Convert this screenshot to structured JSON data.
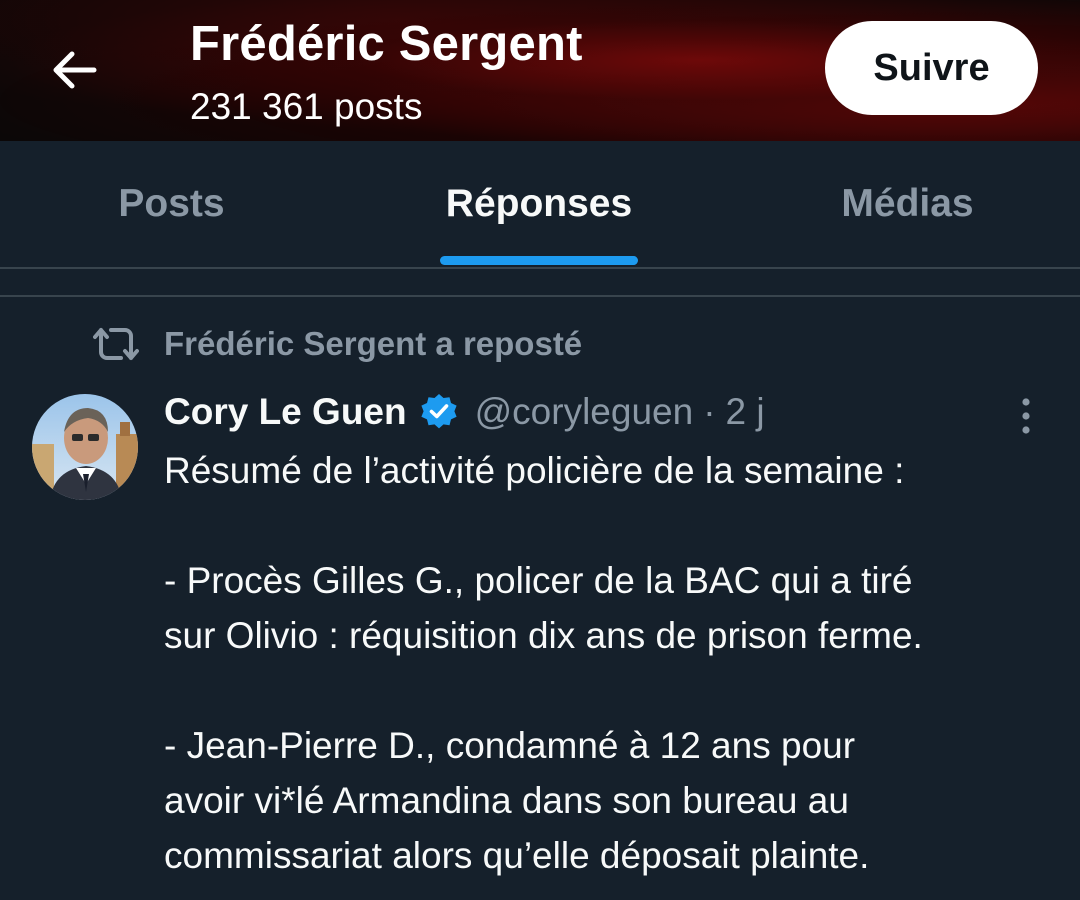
{
  "header": {
    "title": "Frédéric Sergent",
    "post_count": "231 361 posts",
    "follow_label": "Suivre"
  },
  "tabs": [
    {
      "label": "Posts",
      "active": false
    },
    {
      "label": "Réponses",
      "active": true
    },
    {
      "label": "Médias",
      "active": false
    }
  ],
  "tweet": {
    "repost_text": "Frédéric Sergent a reposté",
    "author_name": "Cory Le Guen",
    "verified": true,
    "handle": "@coryleguen",
    "separator": "·",
    "time": "2 j",
    "lines": [
      "Résumé de l’activité policière de la semaine :",
      "- Procès Gilles G., policer de la BAC qui a tiré",
      "sur Olivio : réquisition dix ans de prison ferme.",
      "- Jean-Pierre D., condamné à 12 ans pour",
      "avoir vi*lé Armandina dans son bureau au",
      "commissariat alors qu’elle déposait plainte."
    ]
  },
  "colors": {
    "background": "#15202b",
    "accent": "#1d9bf0",
    "secondary_text": "#8b98a5",
    "primary_text": "#f7f9f9"
  },
  "icons": {
    "back": "arrow-left-icon",
    "repost": "repost-icon",
    "verified": "verified-badge-icon",
    "more": "more-vertical-icon"
  }
}
